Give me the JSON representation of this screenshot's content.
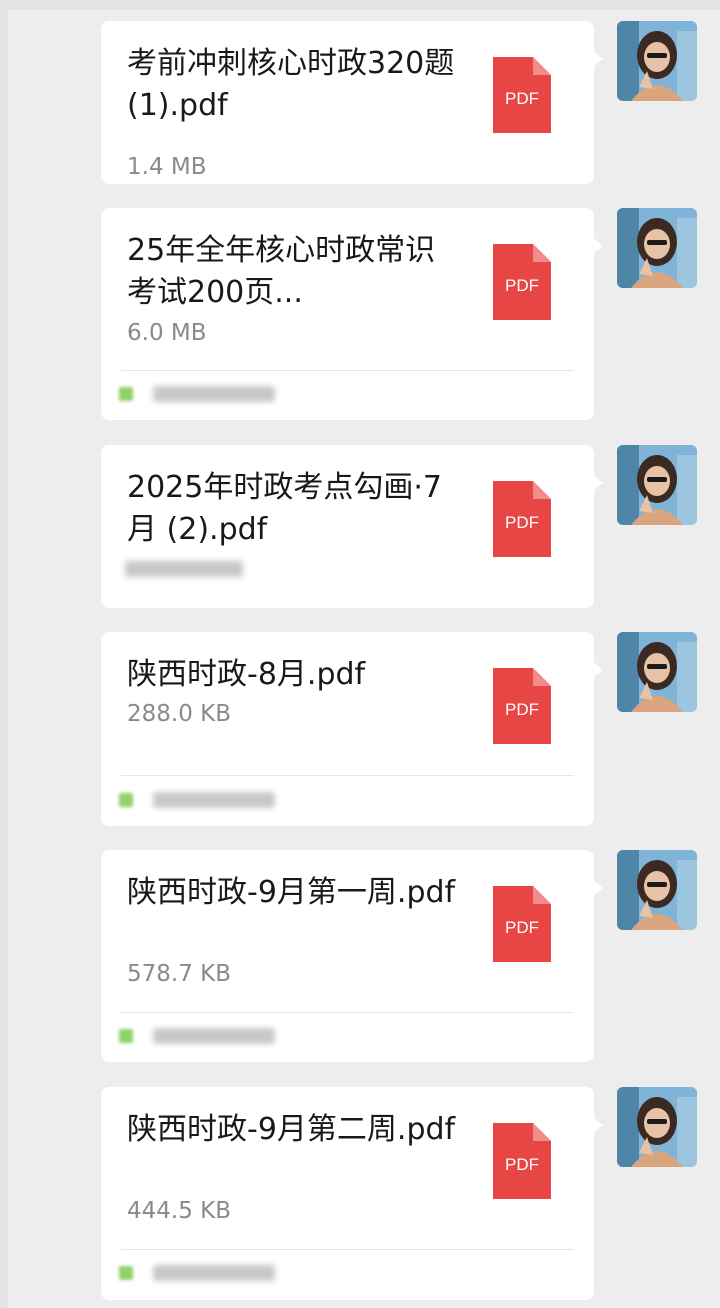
{
  "messages": [
    {
      "name": "考前冲刺核心时政320题(1).pdf",
      "size": "1.4 MB",
      "icon": "pdf-file-icon",
      "icon_label": "PDF",
      "has_source": false
    },
    {
      "name": "25年全年核心时政常识考试200页...",
      "size": "6.0 MB",
      "icon": "pdf-file-icon",
      "icon_label": "PDF",
      "has_source": true
    },
    {
      "name": "2025年时政考点勾画·7月 (2).pdf",
      "size": "",
      "icon": "pdf-file-icon",
      "icon_label": "PDF",
      "has_source": false
    },
    {
      "name": "陕西时政-8月.pdf",
      "size": "288.0 KB",
      "icon": "pdf-file-icon",
      "icon_label": "PDF",
      "has_source": true
    },
    {
      "name": "陕西时政-9月第一周.pdf",
      "size": "578.7 KB",
      "icon": "pdf-file-icon",
      "icon_label": "PDF",
      "has_source": true
    },
    {
      "name": "陕西时政-9月第二周.pdf",
      "size": "444.5 KB",
      "icon": "pdf-file-icon",
      "icon_label": "PDF",
      "has_source": true
    }
  ],
  "colors": {
    "pdf_red": "#e84545",
    "background": "#ededed",
    "bubble": "#ffffff"
  }
}
